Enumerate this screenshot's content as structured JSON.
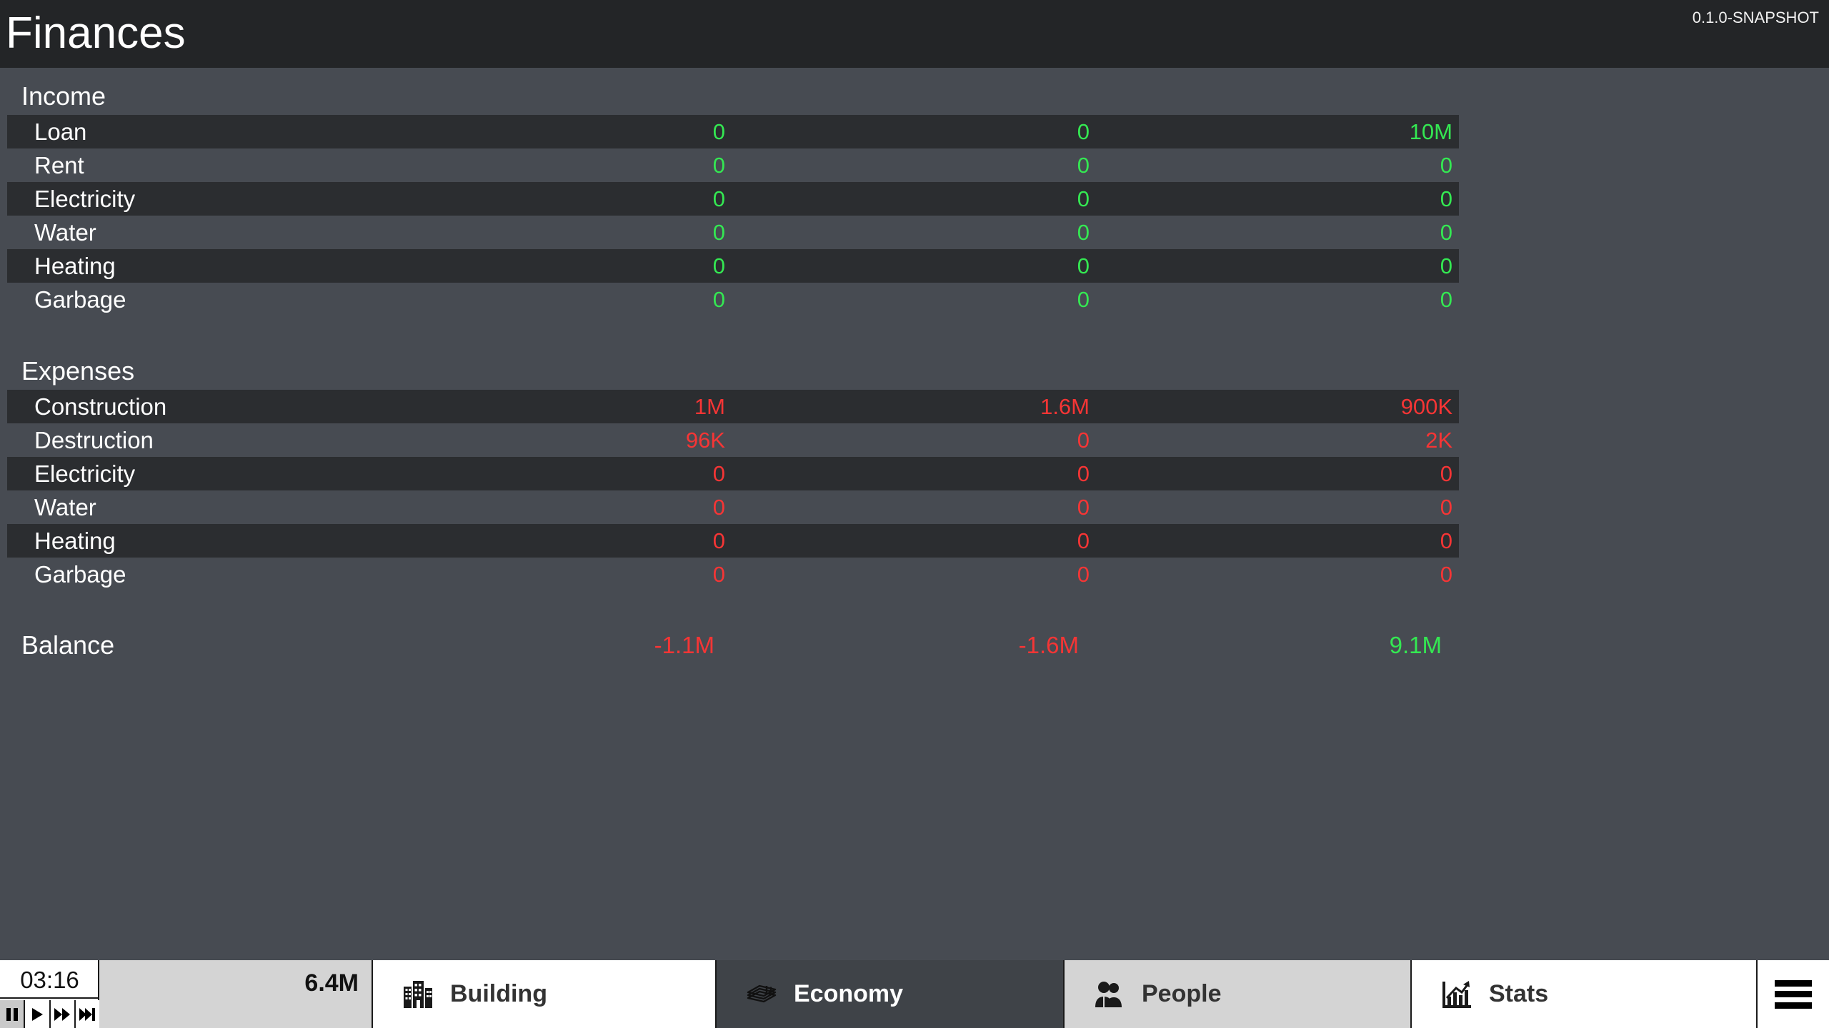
{
  "window": {
    "title": "Finances",
    "version": "0.1.0-SNAPSHOT"
  },
  "colors": {
    "positive": "#34e852",
    "negative": "#f63535",
    "titlebar_bg": "#232527",
    "panel_bg": "#474b52",
    "row_alt_bg": "#2b2d30",
    "tab_active_bg": "#3f4348",
    "tab_hover_bg": "#d4d4d4",
    "money_bg": "#d4d4d4"
  },
  "finances": {
    "income": {
      "title": "Income",
      "rows": [
        {
          "label": "Loan",
          "values": [
            "0",
            "0",
            "10M"
          ],
          "signs": [
            "pos",
            "pos",
            "pos"
          ]
        },
        {
          "label": "Rent",
          "values": [
            "0",
            "0",
            "0"
          ],
          "signs": [
            "pos",
            "pos",
            "pos"
          ]
        },
        {
          "label": "Electricity",
          "values": [
            "0",
            "0",
            "0"
          ],
          "signs": [
            "pos",
            "pos",
            "pos"
          ]
        },
        {
          "label": "Water",
          "values": [
            "0",
            "0",
            "0"
          ],
          "signs": [
            "pos",
            "pos",
            "pos"
          ]
        },
        {
          "label": "Heating",
          "values": [
            "0",
            "0",
            "0"
          ],
          "signs": [
            "pos",
            "pos",
            "pos"
          ]
        },
        {
          "label": "Garbage",
          "values": [
            "0",
            "0",
            "0"
          ],
          "signs": [
            "pos",
            "pos",
            "pos"
          ]
        }
      ]
    },
    "expenses": {
      "title": "Expenses",
      "rows": [
        {
          "label": "Construction",
          "values": [
            "1M",
            "1.6M",
            "900K"
          ],
          "signs": [
            "neg",
            "neg",
            "neg"
          ]
        },
        {
          "label": "Destruction",
          "values": [
            "96K",
            "0",
            "2K"
          ],
          "signs": [
            "neg",
            "neg",
            "neg"
          ]
        },
        {
          "label": "Electricity",
          "values": [
            "0",
            "0",
            "0"
          ],
          "signs": [
            "neg",
            "neg",
            "neg"
          ]
        },
        {
          "label": "Water",
          "values": [
            "0",
            "0",
            "0"
          ],
          "signs": [
            "neg",
            "neg",
            "neg"
          ]
        },
        {
          "label": "Heating",
          "values": [
            "0",
            "0",
            "0"
          ],
          "signs": [
            "neg",
            "neg",
            "neg"
          ]
        },
        {
          "label": "Garbage",
          "values": [
            "0",
            "0",
            "0"
          ],
          "signs": [
            "neg",
            "neg",
            "neg"
          ]
        }
      ]
    },
    "balance": {
      "label": "Balance",
      "values": [
        "-1.1M",
        "-1.6M",
        "9.1M"
      ],
      "signs": [
        "neg",
        "neg",
        "pos"
      ]
    }
  },
  "bottombar": {
    "clock": "03:16",
    "money": "6.4M",
    "speed_buttons": [
      {
        "name": "pause",
        "icon": "pause-icon",
        "active": true
      },
      {
        "name": "play",
        "icon": "play-icon",
        "active": false
      },
      {
        "name": "fast-forward",
        "icon": "fast-forward-icon",
        "active": false
      },
      {
        "name": "skip",
        "icon": "skip-icon",
        "active": false
      }
    ],
    "tabs": [
      {
        "label": "Building",
        "icon": "buildings-icon",
        "state": "normal"
      },
      {
        "label": "Economy",
        "icon": "money-stack-icon",
        "state": "active"
      },
      {
        "label": "People",
        "icon": "people-icon",
        "state": "hover"
      },
      {
        "label": "Stats",
        "icon": "chart-icon",
        "state": "normal"
      }
    ],
    "menu_icon": "hamburger-menu-icon"
  }
}
